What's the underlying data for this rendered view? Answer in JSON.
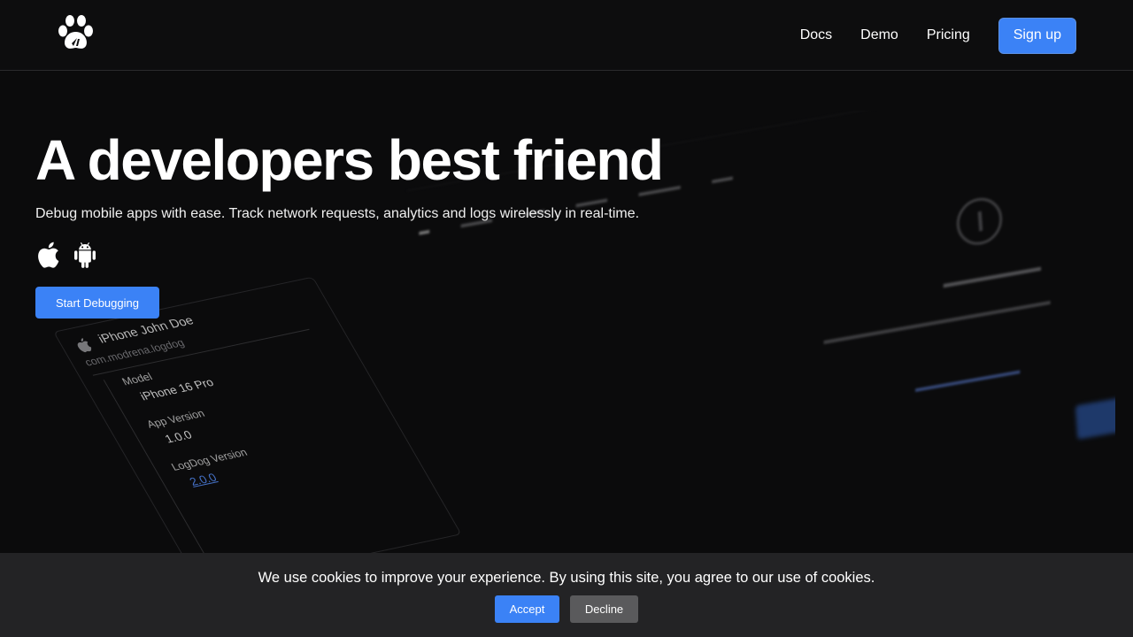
{
  "header": {
    "logo_icon": "paw-logo-icon",
    "nav": [
      {
        "label": "Docs"
      },
      {
        "label": "Demo"
      },
      {
        "label": "Pricing"
      }
    ],
    "signup_label": "Sign up"
  },
  "hero": {
    "title": "A developers best friend",
    "subtitle": "Debug mobile apps with ease. Track network requests, analytics and logs wirelessly in real-time.",
    "platform_icons": [
      "apple-icon",
      "android-icon"
    ],
    "cta_label": "Start Debugging"
  },
  "preview": {
    "device_name": "iPhone John Doe",
    "bundle_id": "com.modrena.logdog",
    "properties": [
      {
        "key": "Model",
        "value": "iPhone 16 Pro"
      },
      {
        "key": "App Version",
        "value": "1.0.0"
      },
      {
        "key": "LogDog Version",
        "value": "2.0.0"
      }
    ]
  },
  "cookie_banner": {
    "message": "We use cookies to improve your experience. By using this site, you agree to our use of cookies.",
    "accept_label": "Accept",
    "decline_label": "Decline"
  },
  "colors": {
    "accent": "#3b82f6",
    "background": "#0b0b0c",
    "cookie_bg": "#232325",
    "decline_bg": "#5a5a5c"
  }
}
